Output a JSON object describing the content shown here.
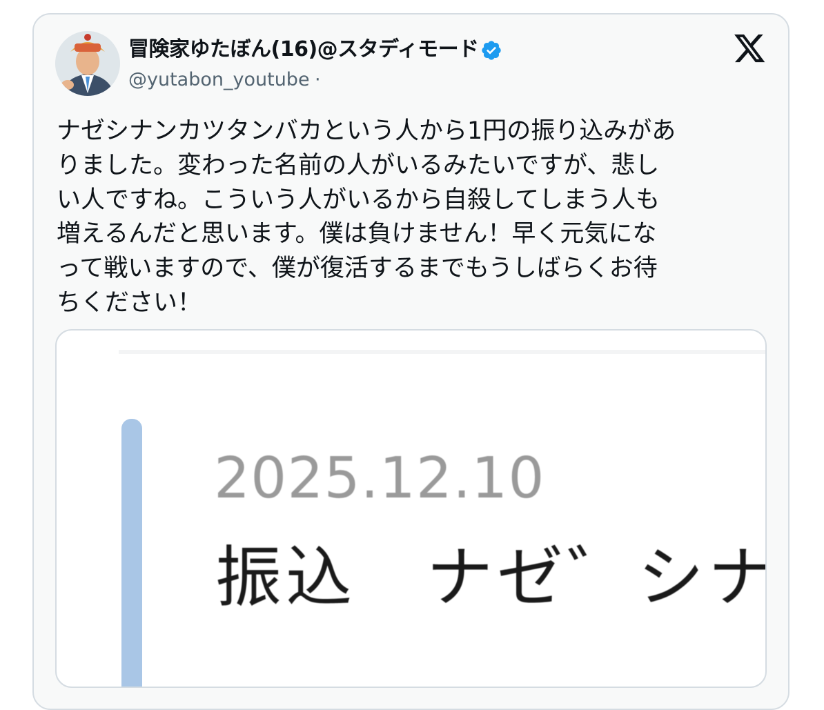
{
  "tweet": {
    "display_name": "冒険家ゆたぼん(16)@スタディモード",
    "handle": "@yutabon_youtube",
    "handle_separator": "·",
    "verified_icon": "verified-badge-icon",
    "platform_icon": "x-logo-icon",
    "text_lines": [
      "ナゼシナンカツタンバカという人から1円の振り込みがあ",
      "りました。変わった名前の人がいるみたいですが、悲し",
      "い人ですね。こういう人がいるから自殺してしまう人も",
      "増えるんだと思います。僕は負けません！早く元気にな",
      "って戦いますので、僕が復活するまでもうしばらくお待",
      "ちください！"
    ],
    "media": {
      "date": "2025.12.10",
      "transfer_line": "振込　ナゼ゛シナ"
    }
  },
  "colors": {
    "verified": "#1d9bf0",
    "text": "#0f1419",
    "secondary_text": "#536471",
    "border": "#d5dce2",
    "card_bg": "#f8f9f9",
    "media_accent_bar": "#a9c6e6"
  }
}
